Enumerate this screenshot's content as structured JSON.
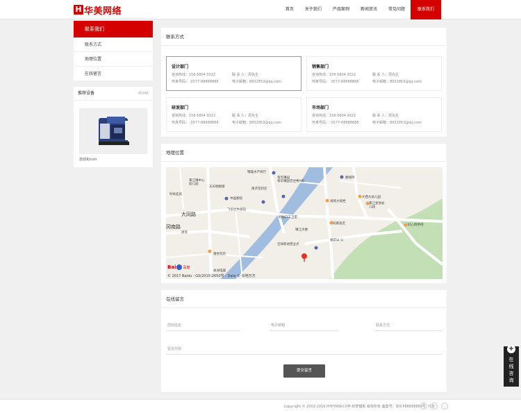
{
  "header": {
    "logo_mark": "H",
    "logo_text": "华美网络",
    "nav": [
      "首页",
      "关于我们",
      "产品案例",
      "新闻资讯",
      "常见问题",
      "联系我们"
    ]
  },
  "sidebar": {
    "head": "联系我们",
    "items": [
      "联系方式",
      "地理位置",
      "在线留言"
    ],
    "recommend_title": "推荐设备",
    "more": "MORE",
    "product_caption": "自动化icon"
  },
  "contact": {
    "title": "联系方式",
    "departments": [
      {
        "name": "设计部门",
        "phone_label": "咨询热线：158 6804 9322",
        "contact_label": "联 系 人：周先生",
        "fax_label": "传真号码：　0577-88888888",
        "email_label": "电子邮箱：8932853@qq.com"
      },
      {
        "name": "销售部门",
        "phone_label": "咨询热线：158 6804 9322",
        "contact_label": "联 系 人：周先生",
        "fax_label": "传真号码：　0577-88888888",
        "email_label": "电子邮箱：8932853@qq.com"
      },
      {
        "name": "研发部门",
        "phone_label": "咨询热线：158 6804 9322",
        "contact_label": "联 系 人：周先生",
        "fax_label": "传真号码：　0577-88888888",
        "email_label": "电子邮箱：8932853@qq.com"
      },
      {
        "name": "市场部门",
        "phone_label": "咨询热线：158 6804 9322",
        "contact_label": "联 系 人：周先生",
        "fax_label": "传真号码：　0577-88888888",
        "email_label": "电子邮箱：8932853@qq.com"
      }
    ]
  },
  "location": {
    "title": "地理位置",
    "attribution": "© 2017 Baidu - GS(2015)2650号 - Data © 长地万方",
    "logo_text": "Bai",
    "logo_suffix": "百度",
    "labels": {
      "l1": "锦雄水产商行",
      "l2": "黄江镇中心幼儿园",
      "l3": "天天明眼镜",
      "l4": "保济堂药店",
      "l5": "育华镇园",
      "l6": "育华镇园音往楼A栋",
      "l7": "鹏翔鸡",
      "l8": "时尚名剪",
      "l9": "中国家纺",
      "l10": "飞华仕牛排馆",
      "l11": "大同路",
      "l12": "海燕大排档",
      "l13": "大西大幼儿园",
      "l14": "黄江星悦幼儿园",
      "l15": "冈南路",
      "l16": "周宅",
      "l17": "同真饭店",
      "l18": "好心情茶吧",
      "l19": "镇江大楼",
      "l20": "吉祥移动营业点",
      "l21": "福华山 公",
      "l22": "蓬悦花店",
      "l23": "本洲电器",
      "l24": "好站口工卫室"
    }
  },
  "message": {
    "title": "在线留言",
    "name_placeholder": "您的姓名",
    "email_placeholder": "电子邮箱",
    "phone_placeholder": "联系方式",
    "content_placeholder": "留言内容",
    "submit": "提交留言"
  },
  "footer": {
    "copyright": "Copyright © 2002-2016 PHPYMW.COM 织梦模板 版权所有 备案号：浙ICP88888888号",
    "share_label": "分享："
  },
  "float": {
    "plus": "+",
    "text": "在线咨询"
  },
  "colors": {
    "brand_red": "#d40000",
    "map_river": "#a0bde0",
    "map_park": "#c3dfb5"
  }
}
